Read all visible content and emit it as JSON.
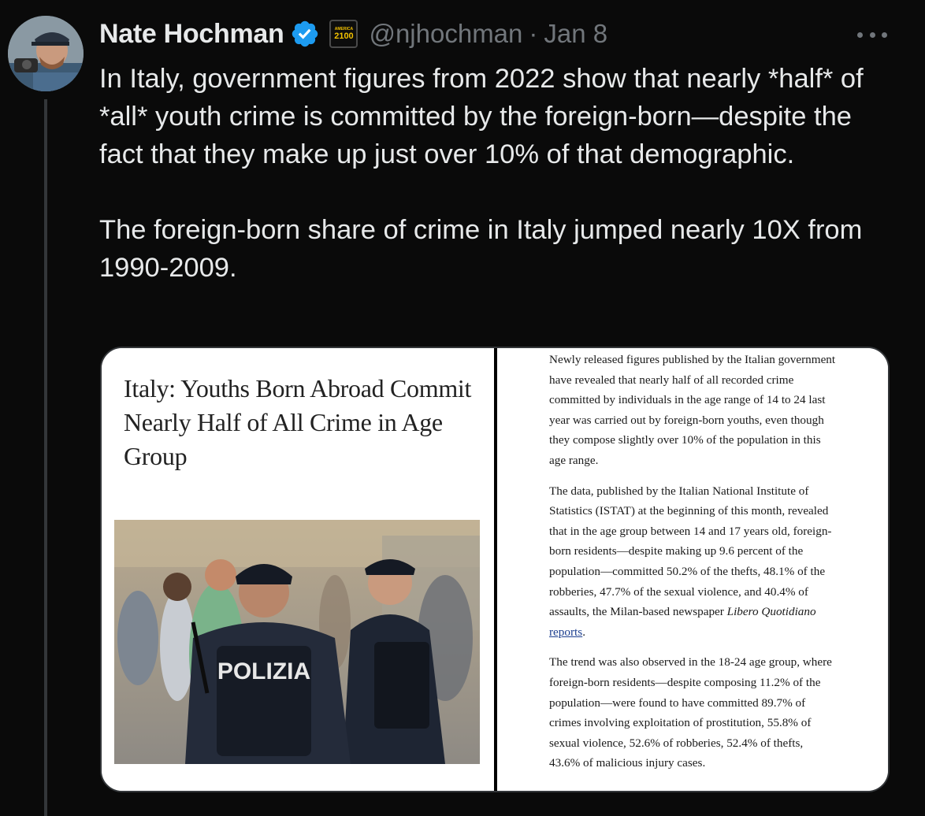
{
  "author": {
    "display_name": "Nate Hochman",
    "handle": "@njhochman",
    "separator": "·",
    "date": "Jan 8",
    "affiliate_badge": {
      "top": "AMERICA",
      "number": "2100"
    }
  },
  "tweet": {
    "paragraph1": "In Italy, government figures from 2022 show that nearly *half* of *all* youth crime is committed by the foreign-born—despite the fact that they make up just over 10% of that demographic.",
    "paragraph2": "The foreign-born share of crime in Italy jumped nearly 10X from 1990-2009."
  },
  "media": {
    "headline": "Italy: Youths Born Abroad Commit Nearly Half of All Crime in Age Group",
    "photo_vest_text": "POLIZIA",
    "article": {
      "p1": "Newly released figures published by the Italian government have revealed that nearly half of all recorded crime committed by individuals in the age range of 14 to 24 last year was carried out by foreign-born youths, even though they compose slightly over 10% of the population in this age range.",
      "p2_before": "The data, published by the Italian National Institute of Statistics (ISTAT) at the beginning of this month, revealed that in the age group between 14 and 17 years old, foreign-born residents—despite making up 9.6 percent of the population—committed 50.2% of the thefts, 48.1% of the robberies, 47.7% of the sexual violence, and 40.4% of assaults, the Milan-based newspaper ",
      "p2_source": "Libero Quotidiano",
      "p2_link": "reports",
      "p2_end": ".",
      "p3": "The trend was also observed in the 18-24 age group, where foreign-born residents—despite composing 11.2% of the population—were found to have committed 89.7% of crimes involving exploitation of prostitution, 55.8% of sexual violence, 52.6% of robberies, 52.4% of thefts, 43.6% of malicious injury cases."
    }
  },
  "icons": {
    "verified": "verified-badge-icon",
    "more": "more-options-icon"
  },
  "colors": {
    "background": "#0a0a0a",
    "text_primary": "#e7e9ea",
    "text_secondary": "#71767b",
    "verified_blue": "#1d9bf0",
    "affiliate_gold": "#f2c100"
  }
}
